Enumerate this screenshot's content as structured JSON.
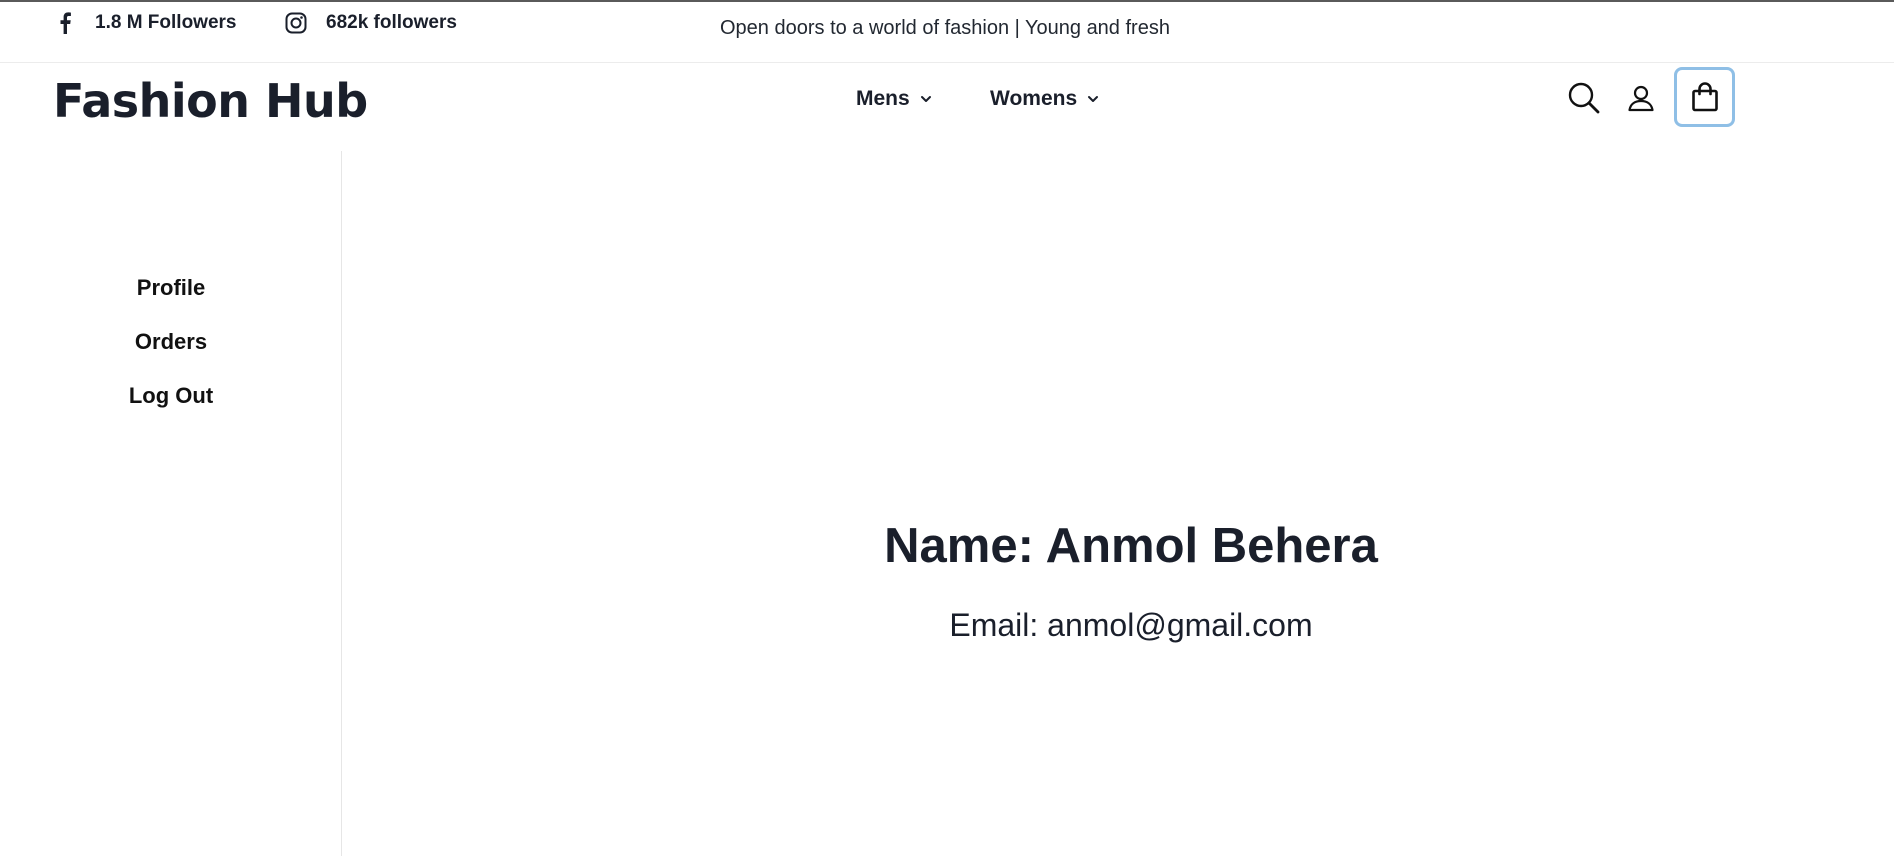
{
  "topbar": {
    "facebook": {
      "icon": "facebook-icon",
      "label": "1.8 M Followers"
    },
    "instagram": {
      "icon": "instagram-icon",
      "label": "682k followers"
    },
    "tagline": "Open doors to a world of fashion | Young and fresh"
  },
  "header": {
    "brand": "Fashion Hub",
    "nav": [
      {
        "label": "Mens",
        "icon": "chevron-down-icon"
      },
      {
        "label": "Womens",
        "icon": "chevron-down-icon"
      }
    ],
    "icons": [
      "search-icon",
      "user-icon",
      "shopping-bag-icon"
    ],
    "focus_color": "#8fbfe6"
  },
  "sidebar": {
    "items": [
      {
        "label": "Profile"
      },
      {
        "label": "Orders"
      },
      {
        "label": "Log Out"
      }
    ]
  },
  "profile": {
    "name_line": "Name: Anmol Behera",
    "email_line": "Email: anmol@gmail.com"
  }
}
